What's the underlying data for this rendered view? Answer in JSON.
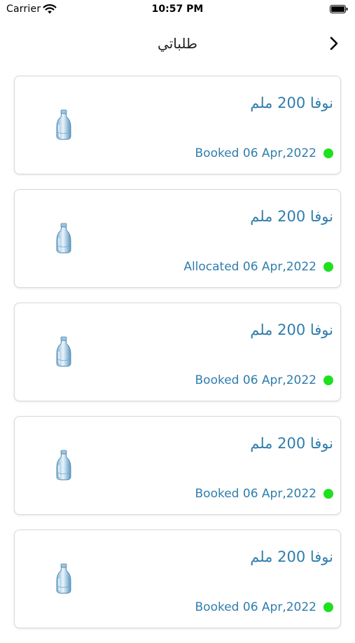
{
  "status_bar": {
    "carrier": "Carrier",
    "time": "10:57 PM"
  },
  "nav": {
    "title": "طلباتي"
  },
  "orders": [
    {
      "product": "نوفا 200 ملم",
      "status": "Booked 06 Apr,2022",
      "status_color": "#1ee01e"
    },
    {
      "product": "نوفا 200 ملم",
      "status": "Allocated 06 Apr,2022",
      "status_color": "#1ee01e"
    },
    {
      "product": "نوفا 200 ملم",
      "status": "Booked 06 Apr,2022",
      "status_color": "#1ee01e"
    },
    {
      "product": "نوفا 200 ملم",
      "status": "Booked 06 Apr,2022",
      "status_color": "#1ee01e"
    },
    {
      "product": "نوفا 200 ملم",
      "status": "Booked 06 Apr,2022",
      "status_color": "#1ee01e"
    }
  ],
  "colors": {
    "accent_text": "#2f7dad",
    "status_dot": "#1ee01e"
  },
  "icons": {
    "wifi": "wifi-icon",
    "battery": "battery-icon",
    "back": "chevron-right-icon",
    "product": "water-bottle-icon"
  }
}
